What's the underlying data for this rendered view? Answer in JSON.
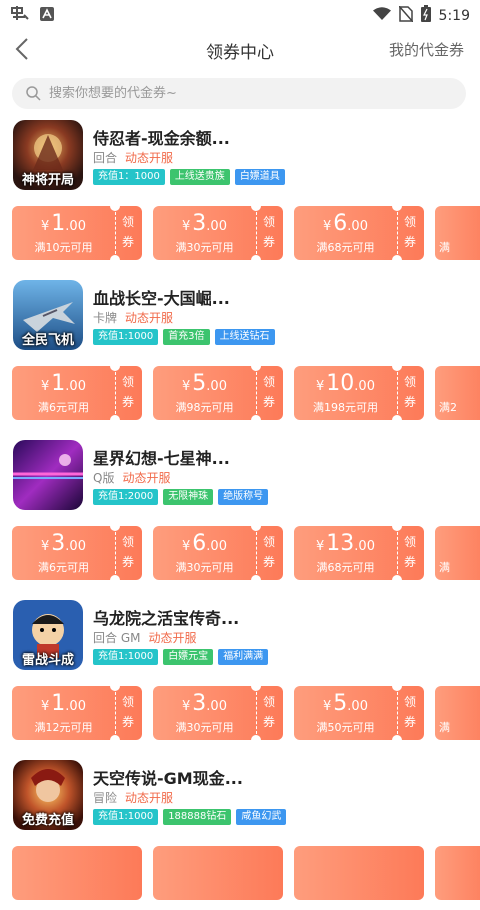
{
  "status_bar": {
    "time": "5:19",
    "left_icons": [
      "app-logo-icon",
      "a-badge-icon"
    ],
    "right_icons": [
      "wifi-icon",
      "no-sim-icon",
      "battery-icon"
    ]
  },
  "nav": {
    "title": "领券中心",
    "right_link": "我的代金券"
  },
  "search": {
    "placeholder": "搜索你想要的代金券~"
  },
  "games": [
    {
      "name": "侍忍者-现金余额...",
      "category": "回合",
      "status": "动态开服",
      "tags": [
        "充值1：1000",
        "上线送贵族",
        "白嫖道具"
      ],
      "icon_caption": "神将开局",
      "coupons": [
        {
          "currency": "¥",
          "int": "1",
          "dec": ".00",
          "condition": "满10元可用"
        },
        {
          "currency": "¥",
          "int": "3",
          "dec": ".00",
          "condition": "满30元可用"
        },
        {
          "currency": "¥",
          "int": "6",
          "dec": ".00",
          "condition": "满68元可用"
        }
      ]
    },
    {
      "name": "血战长空-大国崛...",
      "category": "卡牌",
      "status": "动态开服",
      "tags": [
        "充值1:1000",
        "首充3倍",
        "上线送钻石"
      ],
      "icon_caption": "全民飞机",
      "coupons": [
        {
          "currency": "¥",
          "int": "1",
          "dec": ".00",
          "condition": "满6元可用"
        },
        {
          "currency": "¥",
          "int": "5",
          "dec": ".00",
          "condition": "满98元可用"
        },
        {
          "currency": "¥",
          "int": "10",
          "dec": ".00",
          "condition": "满198元可用"
        }
      ]
    },
    {
      "name": "星界幻想-七星神...",
      "category": "Q版",
      "status": "动态开服",
      "tags": [
        "充值1:2000",
        "无限神珠",
        "绝版称号"
      ],
      "icon_caption": "",
      "coupons": [
        {
          "currency": "¥",
          "int": "3",
          "dec": ".00",
          "condition": "满6元可用"
        },
        {
          "currency": "¥",
          "int": "6",
          "dec": ".00",
          "condition": "满30元可用"
        },
        {
          "currency": "¥",
          "int": "13",
          "dec": ".00",
          "condition": "满68元可用"
        }
      ]
    },
    {
      "name": "乌龙院之活宝传奇...",
      "category": "回合 GM",
      "status": "动态开服",
      "tags": [
        "充值1:1000",
        "白嫖元宝",
        "福利满满"
      ],
      "icon_caption": "雷战斗成",
      "coupons": [
        {
          "currency": "¥",
          "int": "1",
          "dec": ".00",
          "condition": "满12元可用"
        },
        {
          "currency": "¥",
          "int": "3",
          "dec": ".00",
          "condition": "满30元可用"
        },
        {
          "currency": "¥",
          "int": "5",
          "dec": ".00",
          "condition": "满50元可用"
        }
      ]
    },
    {
      "name": "天空传说-GM现金...",
      "category": "冒险",
      "status": "动态开服",
      "tags": [
        "充值1:1000",
        "188888钻石",
        "咸鱼幻武"
      ],
      "icon_caption": "免费充值",
      "coupons": []
    }
  ],
  "coupon_claim_label": "领券",
  "partial_coupon_labels": [
    "满",
    "满2",
    "满",
    "满",
    ""
  ],
  "colors": {
    "coupon_start": "#fe9d7d",
    "coupon_end": "#fd7a58",
    "status_red": "#f16a4a",
    "tag_teal": "#25c4c9",
    "tag_green": "#3cc46e",
    "tag_blue": "#3d97f0"
  }
}
